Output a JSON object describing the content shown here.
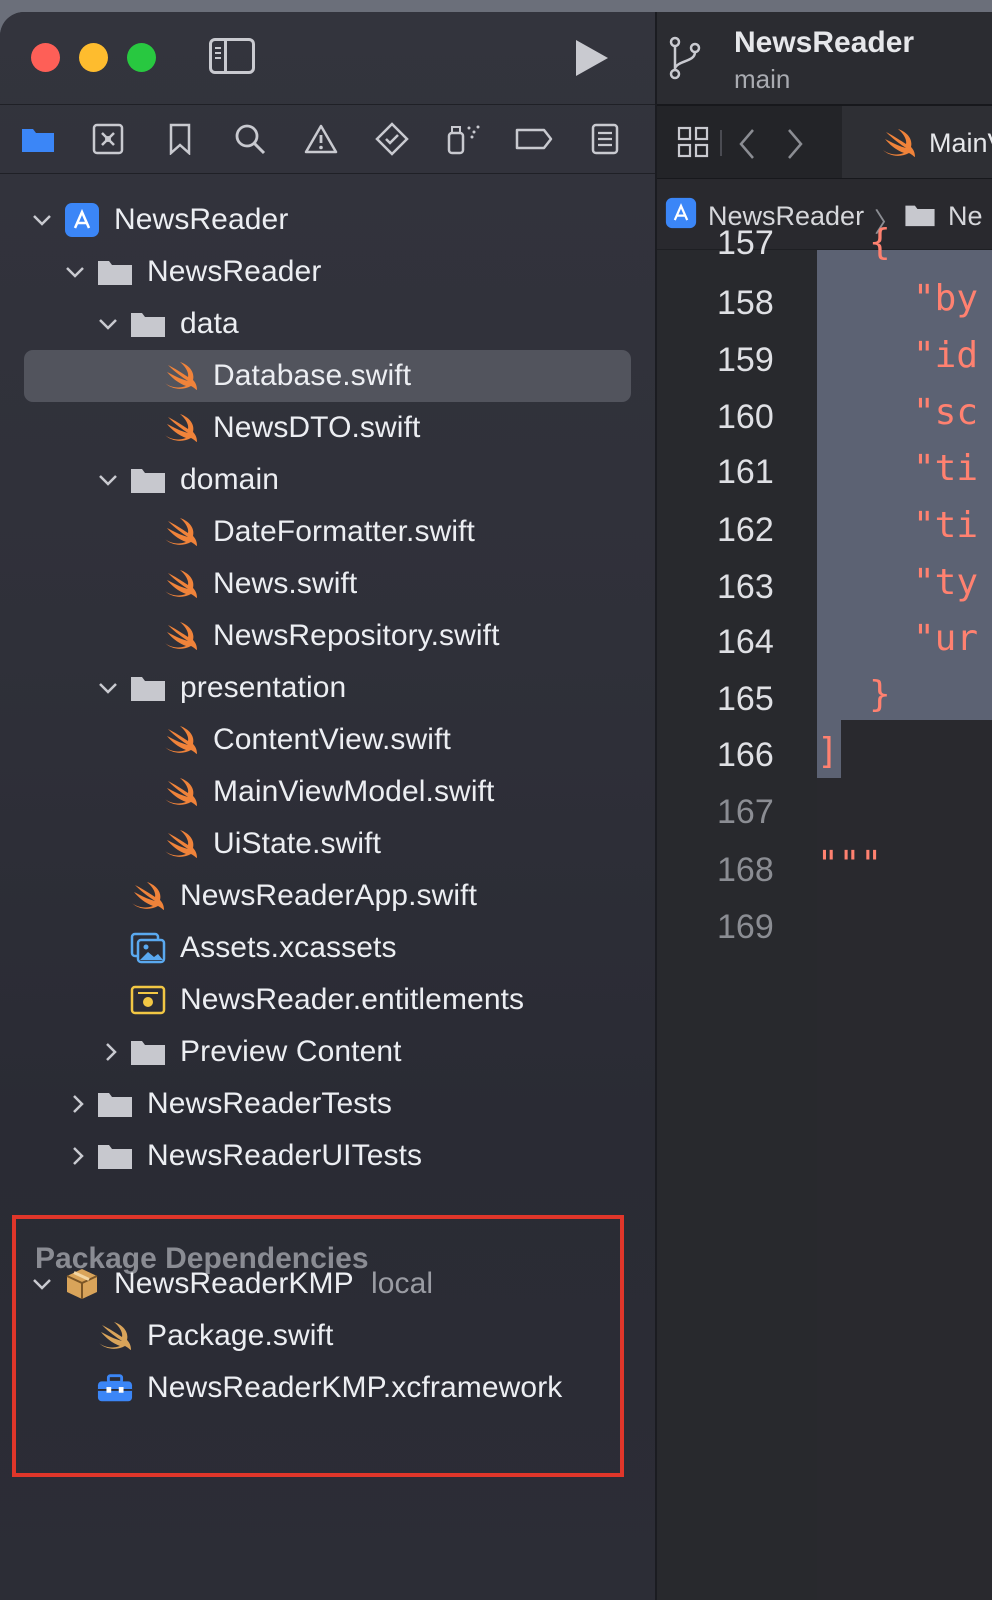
{
  "editor": {
    "project_name": "NewsReader",
    "branch": "main",
    "tab_label": "MainV",
    "jumpbar": {
      "project": "NewsReader",
      "folder": "Ne",
      "separator": "〉"
    },
    "line_numbers": [
      "157",
      "158",
      "159",
      "160",
      "161",
      "162",
      "163",
      "164",
      "165",
      "166",
      "167",
      "168",
      "169"
    ],
    "code_lines": [
      "{",
      "\"by",
      "\"id",
      "\"sc",
      "\"ti",
      "\"ti",
      "\"ty",
      "\"ur",
      "}",
      "]",
      "",
      "\"\"\"",
      ""
    ]
  },
  "tree": {
    "root": "NewsReader",
    "group": "NewsReader",
    "folders": {
      "data": "data",
      "domain": "domain",
      "presentation": "presentation",
      "preview": "Preview Content"
    },
    "files": {
      "database": "Database.swift",
      "newsdto": "NewsDTO.swift",
      "dateformatter": "DateFormatter.swift",
      "news": "News.swift",
      "newsrepository": "NewsRepository.swift",
      "contentview": "ContentView.swift",
      "mainviewmodel": "MainViewModel.swift",
      "uistate": "UiState.swift",
      "newsreaderapp": "NewsReaderApp.swift",
      "assets": "Assets.xcassets",
      "entitlements": "NewsReader.entitlements"
    },
    "tests": "NewsReaderTests",
    "uitests": "NewsReaderUITests"
  },
  "packages": {
    "title": "Package Dependencies",
    "name": "NewsReaderKMP",
    "tag": "local",
    "package_swift": "Package.swift",
    "framework": "NewsReaderKMP.xcframework"
  },
  "colors": {
    "swift": "#f0833a",
    "folder": "#c7c8ce",
    "accent": "#3b86f7",
    "highlight_box": "#e0362a",
    "code": "#ff8170"
  }
}
